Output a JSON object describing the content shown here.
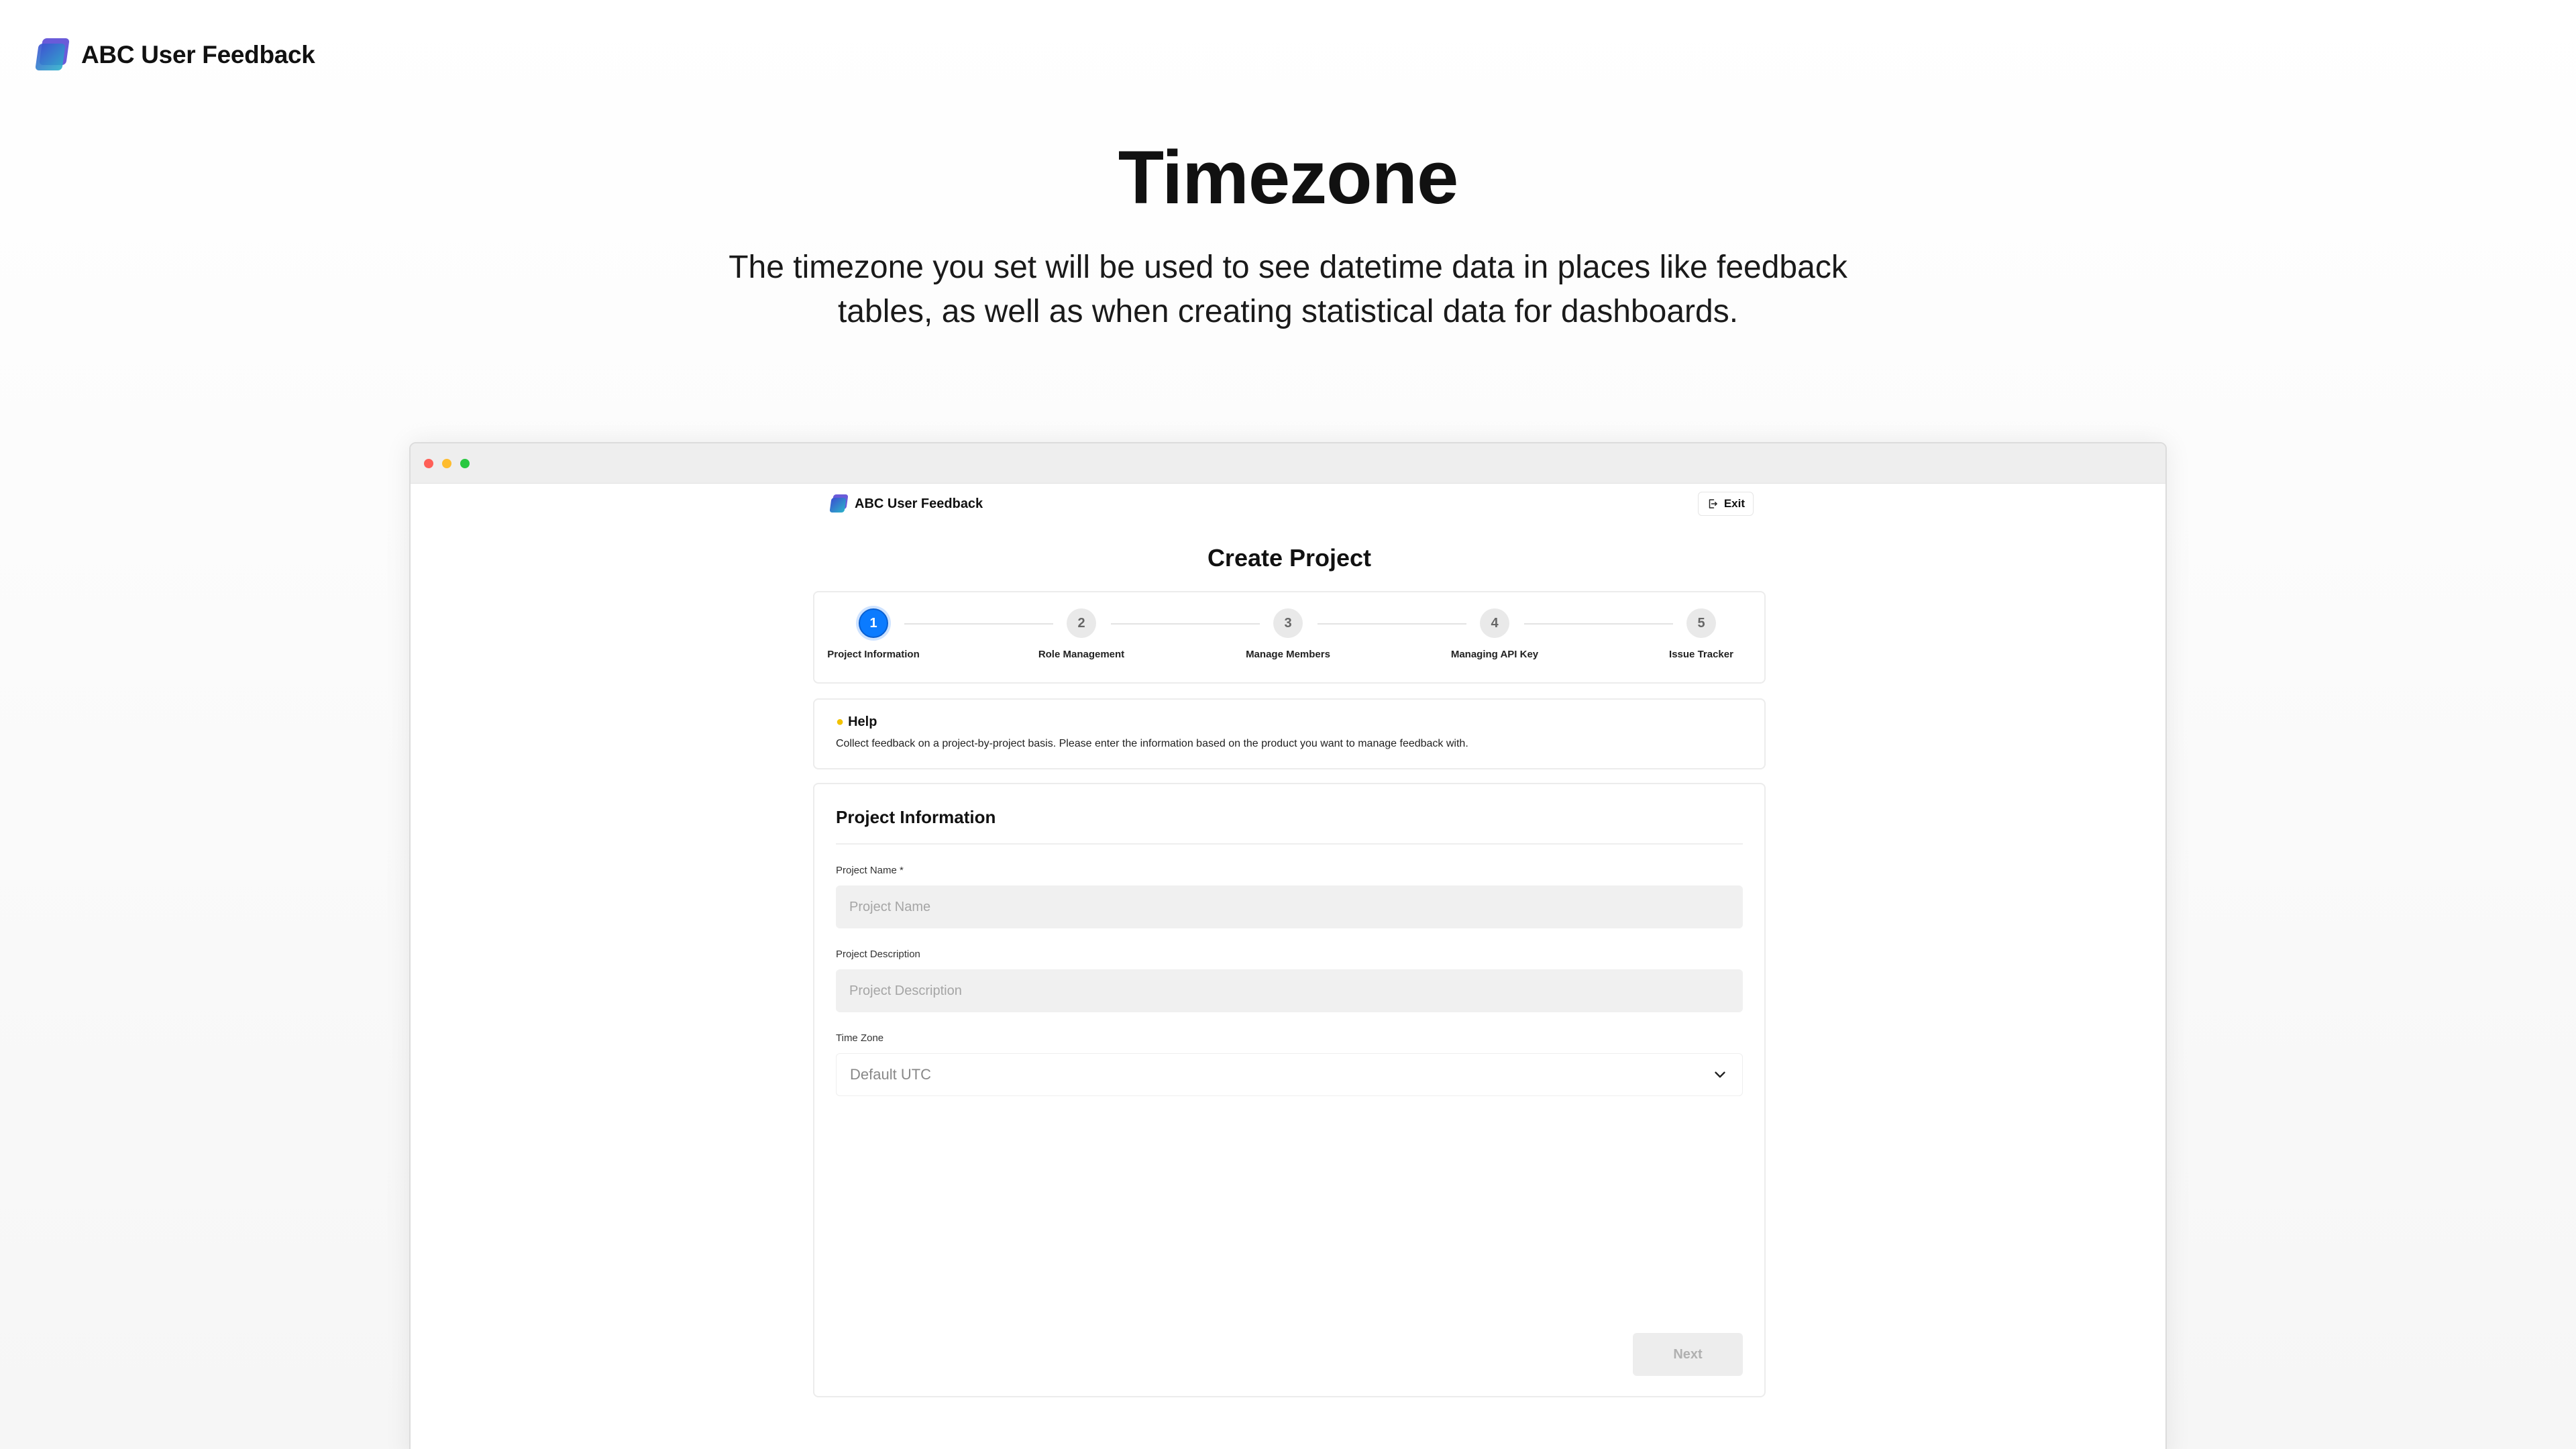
{
  "brand": {
    "name": "ABC User Feedback"
  },
  "hero": {
    "title": "Timezone",
    "subtitle": "The timezone you set will be used to see datetime data in places like feedback tables, as well as when creating statistical data for dashboards."
  },
  "app": {
    "brand_name": "ABC User Feedback",
    "exit_label": "Exit",
    "page_title": "Create Project",
    "steps": [
      {
        "number": "1",
        "label": "Project Information",
        "active": true
      },
      {
        "number": "2",
        "label": "Role Management",
        "active": false
      },
      {
        "number": "3",
        "label": "Manage Members",
        "active": false
      },
      {
        "number": "4",
        "label": "Managing API Key",
        "active": false
      },
      {
        "number": "5",
        "label": "Issue Tracker",
        "active": false
      }
    ],
    "help": {
      "title": "Help",
      "text": "Collect feedback on a project-by-project basis. Please enter the information based on the product you want to manage feedback with."
    },
    "form": {
      "section_title": "Project Information",
      "project_name_label": "Project Name *",
      "project_name_placeholder": "Project Name",
      "project_description_label": "Project Description",
      "project_description_placeholder": "Project Description",
      "timezone_label": "Time Zone",
      "timezone_value": "Default UTC",
      "next_label": "Next"
    }
  },
  "colors": {
    "accent": "#0b7bff",
    "traffic_red": "#ff5f57",
    "traffic_yellow": "#febc2e",
    "traffic_green": "#28c840"
  }
}
